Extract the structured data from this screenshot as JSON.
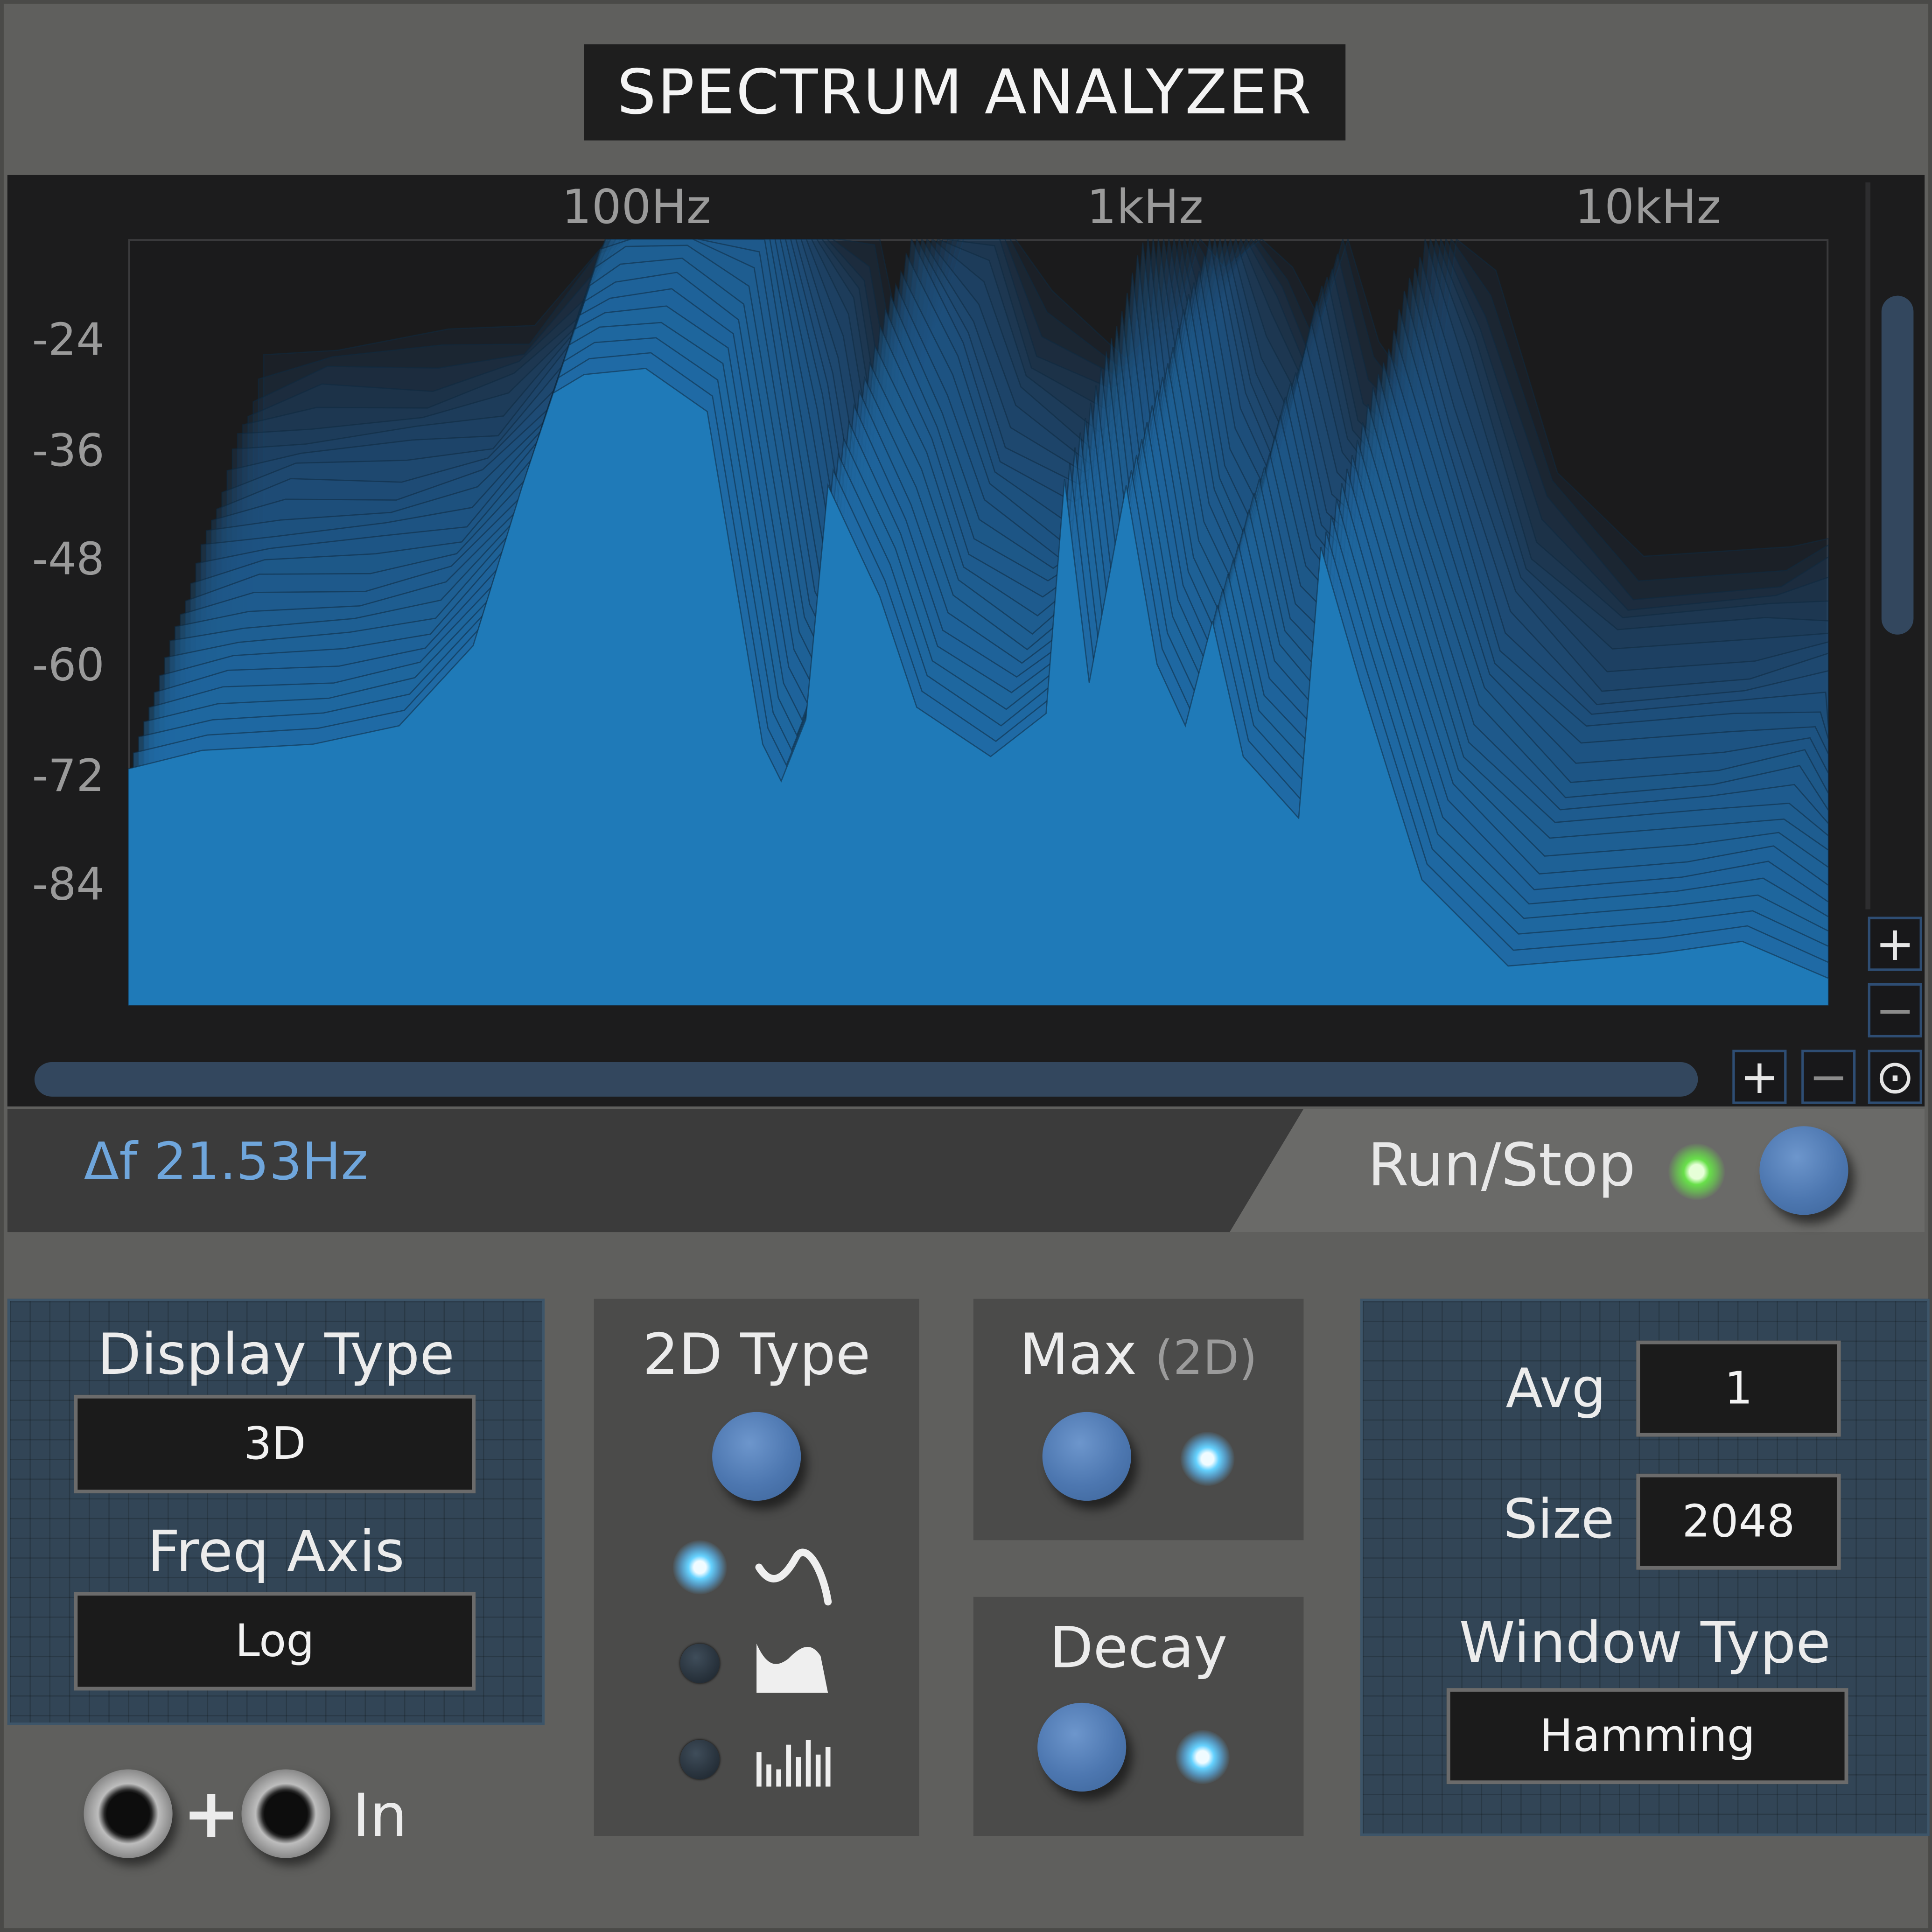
{
  "title": "SPECTRUM ANALYZER",
  "freq_axis_labels": [
    "100Hz",
    "1kHz",
    "10kHz"
  ],
  "db_axis_labels": [
    "-24",
    "-36",
    "-48",
    "-60",
    "-72",
    "-84"
  ],
  "zoom_vertical": {
    "plus": "+",
    "minus": "−"
  },
  "zoom_horizontal": {
    "plus": "+",
    "minus": "−",
    "reset": "⊙"
  },
  "status": {
    "delta_f": "Δf 21.53Hz",
    "run_stop_label": "Run/Stop",
    "running": true
  },
  "display_type": {
    "label": "Display Type",
    "value": "3D"
  },
  "freq_axis": {
    "label": "Freq Axis",
    "value": "Log"
  },
  "two_d_type": {
    "label": "2D Type",
    "options": [
      "line",
      "filled",
      "bars"
    ],
    "selected": "line"
  },
  "max": {
    "label": "Max",
    "suffix": "(2D)",
    "active": true
  },
  "decay": {
    "label": "Decay",
    "active": true
  },
  "avg": {
    "label": "Avg",
    "value": "1"
  },
  "size": {
    "label": "Size",
    "value": "2048"
  },
  "window_type": {
    "label": "Window Type",
    "value": "Hamming"
  },
  "input": {
    "label": "In",
    "plus": "+"
  },
  "colors": {
    "spectrum": "#1f7ab8",
    "led_green": "#68e04a",
    "led_blue": "#65d2ff",
    "panel_blue": "#324556"
  }
}
